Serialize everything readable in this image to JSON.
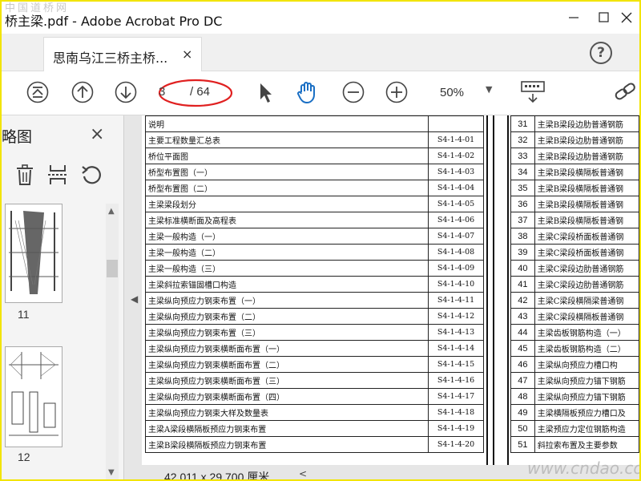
{
  "window": {
    "title": "桥主梁.pdf - Adobe Acrobat Pro DC",
    "watermark_top": "中国道桥网",
    "watermark_bottom": "www.cndao.com"
  },
  "tabs": [
    {
      "label": "思南乌江三桥主桥...",
      "close": "×"
    }
  ],
  "help_label": "?",
  "toolbar": {
    "current_page": "3",
    "page_total": "/ 64",
    "zoom": "50%"
  },
  "sidebar": {
    "title": "略图",
    "close": "×",
    "thumbnails": [
      {
        "label": "11"
      },
      {
        "label": "12"
      }
    ]
  },
  "document": {
    "left_rows": [
      {
        "name": "说明",
        "code": ""
      },
      {
        "name": "主要工程数量汇总表",
        "code": "S4-1-4-01"
      },
      {
        "name": "桥位平面图",
        "code": "S4-1-4-02"
      },
      {
        "name": "桥型布置图（一）",
        "code": "S4-1-4-03"
      },
      {
        "name": "桥型布置图（二）",
        "code": "S4-1-4-04"
      },
      {
        "name": "主梁梁段划分",
        "code": "S4-1-4-05"
      },
      {
        "name": "主梁标准横断面及高程表",
        "code": "S4-1-4-06"
      },
      {
        "name": "主梁一般构造（一）",
        "code": "S4-1-4-07"
      },
      {
        "name": "主梁一般构造（二）",
        "code": "S4-1-4-08"
      },
      {
        "name": "主梁一般构造（三）",
        "code": "S4-1-4-09"
      },
      {
        "name": "主梁斜拉索锚固槽口构造",
        "code": "S4-1-4-10"
      },
      {
        "name": "主梁纵向预应力钢束布置（一）",
        "code": "S4-1-4-11"
      },
      {
        "name": "主梁纵向预应力钢束布置（二）",
        "code": "S4-1-4-12"
      },
      {
        "name": "主梁纵向预应力钢束布置（三）",
        "code": "S4-1-4-13"
      },
      {
        "name": "主梁纵向预应力钢束横断面布置（一）",
        "code": "S4-1-4-14"
      },
      {
        "name": "主梁纵向预应力钢束横断面布置（二）",
        "code": "S4-1-4-15"
      },
      {
        "name": "主梁纵向预应力钢束横断面布置（三）",
        "code": "S4-1-4-16"
      },
      {
        "name": "主梁纵向预应力钢束横断面布置（四）",
        "code": "S4-1-4-17"
      },
      {
        "name": "主梁纵向预应力钢束大样及数量表",
        "code": "S4-1-4-18"
      },
      {
        "name": "主梁A梁段横隔板预应力钢束布置",
        "code": "S4-1-4-19"
      },
      {
        "name": "主梁B梁段横隔板预应力钢束布置",
        "code": "S4-1-4-20"
      }
    ],
    "right_rows": [
      {
        "no": "31",
        "name": "主梁B梁段边肋普通钢筋"
      },
      {
        "no": "32",
        "name": "主梁B梁段边肋普通钢筋"
      },
      {
        "no": "33",
        "name": "主梁B梁段边肋普通钢筋"
      },
      {
        "no": "34",
        "name": "主梁B梁段横隔板普通钢"
      },
      {
        "no": "35",
        "name": "主梁B梁段横隔板普通钢"
      },
      {
        "no": "36",
        "name": "主梁B梁段横隔板普通钢"
      },
      {
        "no": "37",
        "name": "主梁B梁段横隔板普通钢"
      },
      {
        "no": "38",
        "name": "主梁C梁段桥面板普通钢"
      },
      {
        "no": "39",
        "name": "主梁C梁段桥面板普通钢"
      },
      {
        "no": "40",
        "name": "主梁C梁段边肋普通钢筋"
      },
      {
        "no": "41",
        "name": "主梁C梁段边肋普通钢筋"
      },
      {
        "no": "42",
        "name": "主梁C梁段横隔梁普通钢"
      },
      {
        "no": "43",
        "name": "主梁C梁段横隔板普通钢"
      },
      {
        "no": "44",
        "name": "主梁齿板钢筋构造（一）"
      },
      {
        "no": "45",
        "name": "主梁齿板钢筋构造（二）"
      },
      {
        "no": "46",
        "name": "主梁纵向预应力槽口构"
      },
      {
        "no": "47",
        "name": "主梁纵向预应力锚下钢筋"
      },
      {
        "no": "48",
        "name": "主梁纵向预应力锚下钢筋"
      },
      {
        "no": "49",
        "name": "主梁横隔板预应力槽口及"
      },
      {
        "no": "50",
        "name": "主梁预应力定位钢筋构造"
      },
      {
        "no": "51",
        "name": "斜拉索布置及主要参数"
      }
    ]
  },
  "status": {
    "dimensions": "42.011 x 29.700 厘米"
  },
  "colors": {
    "frame": "#f2e400",
    "annotation_circle": "#e02020"
  }
}
